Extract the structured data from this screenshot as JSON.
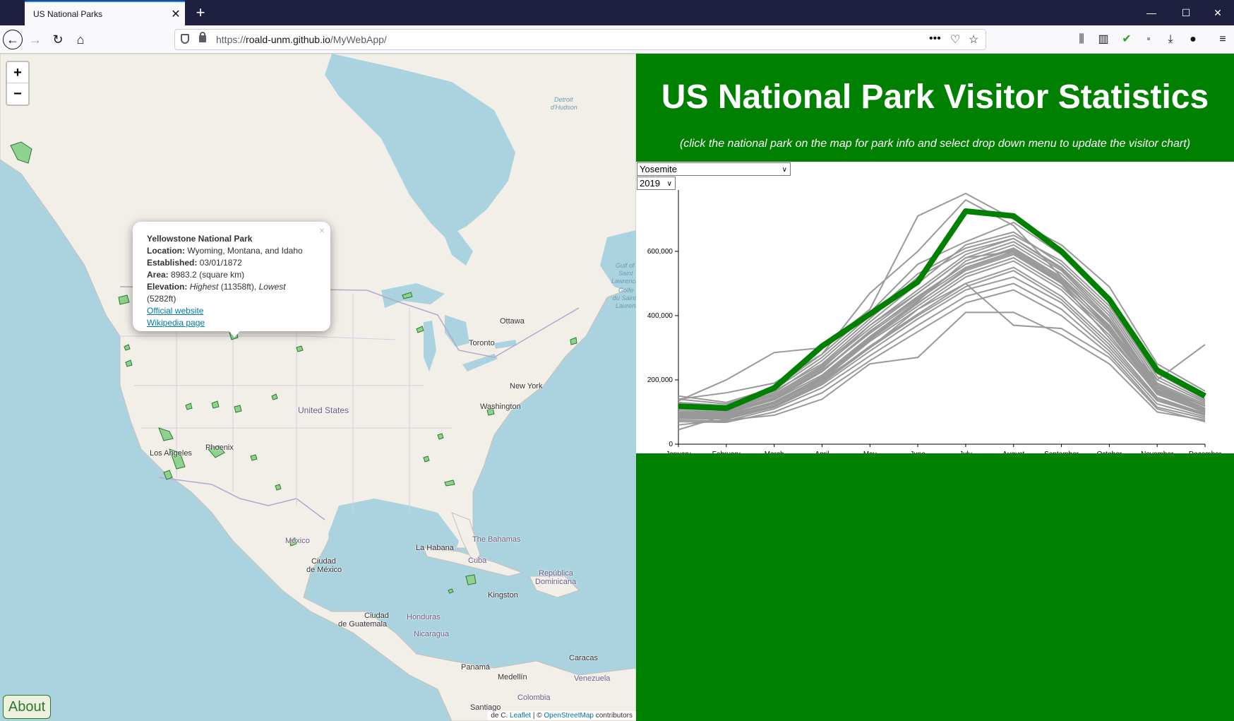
{
  "browser": {
    "tab_title": "US National Parks",
    "url_prefix": "https://",
    "url_host": "roald-unm.github.io",
    "url_path": "/MyWebApp/"
  },
  "map": {
    "zoom_in": "+",
    "zoom_out": "−",
    "popup": {
      "close": "×",
      "name": "Yellowstone National Park",
      "location_label": "Location:",
      "location": "Wyoming, Montana, and Idaho",
      "established_label": "Established:",
      "established": "03/01/1872",
      "area_label": "Area:",
      "area": "8983.2 (square km)",
      "elevation_label": "Elevation:",
      "elev_highest_label": "Highest",
      "elev_highest": "(11358ft),",
      "elev_lowest_label": "Lowest",
      "elev_lowest": "(5282ft)",
      "official_link": "Official website",
      "wiki_link": "Wikipedia page"
    },
    "labels": {
      "ottawa": "Ottawa",
      "toronto": "Toronto",
      "new_york": "New York",
      "washington": "Washington",
      "united_states": "United States",
      "phoenix": "Phoenix",
      "los_angeles": "Los Angeles",
      "mexico": "México",
      "ciudad_mexico_1": "Ciudad",
      "ciudad_mexico_2": "de México",
      "la_habana": "La Habana",
      "the_bahamas": "The Bahamas",
      "cuba": "Cuba",
      "republica_1": "República",
      "republica_2": "Dominicana",
      "kingston": "Kingston",
      "ciudad_guatemala_1": "Ciudad",
      "ciudad_guatemala_2": "de Guatemala",
      "honduras": "Honduras",
      "nicaragua": "Nicaragua",
      "panama": "Panamá",
      "caracas": "Caracas",
      "venezuela": "Venezuela",
      "medellin": "Medellín",
      "colombia": "Colombia",
      "santiago_1": "Santiago",
      "santiago_2": "de C.",
      "detroit": "Detroit",
      "detroit_2": "d'Hudson",
      "gulf": "Gulf of",
      "gulf_2": "Saint",
      "gulf_3": "Lawrence",
      "gulf_4": "Golfe",
      "gulf_5": "du Saint-",
      "gulf_6": "Laurent"
    },
    "about": "About",
    "attribution": {
      "leaflet": "Leaflet",
      "sep": " | © ",
      "osm": "OpenStreetMap",
      "contributors": " contributors"
    },
    "colors": {
      "water": "#aad3df",
      "land": "#f2efe9",
      "park": "#8fd18f",
      "park_stroke": "#2c7a2c"
    }
  },
  "panel": {
    "title": "US National Park Visitor Statistics",
    "subtitle": "(click the national park on the map for park info and select drop down menu to update the visitor chart)",
    "park_select": "Yosemite",
    "year_select": "2019",
    "colors": {
      "bg": "#008000",
      "highlight": "#008000",
      "others": "#999999"
    }
  },
  "chart_data": {
    "type": "line",
    "categories": [
      "January",
      "February",
      "March",
      "April",
      "May",
      "June",
      "July",
      "August",
      "September",
      "October",
      "November",
      "December"
    ],
    "yticks": [
      0,
      200000,
      400000,
      600000
    ],
    "ytick_labels": [
      "0",
      "200,000",
      "400,000",
      "600,000"
    ],
    "ylim": [
      0,
      780000
    ],
    "highlight": {
      "name": "Yosemite",
      "values": [
        118000,
        112000,
        175000,
        305000,
        405000,
        505000,
        725000,
        710000,
        600000,
        450000,
        230000,
        150000
      ]
    },
    "series": [
      {
        "values": [
          130000,
          120000,
          165000,
          250000,
          380000,
          500000,
          620000,
          660000,
          560000,
          420000,
          200000,
          130000
        ]
      },
      {
        "values": [
          110000,
          105000,
          150000,
          240000,
          360000,
          470000,
          580000,
          630000,
          540000,
          390000,
          185000,
          120000
        ]
      },
      {
        "values": [
          100000,
          98000,
          140000,
          225000,
          350000,
          460000,
          560000,
          610000,
          520000,
          380000,
          175000,
          110000
        ]
      },
      {
        "values": [
          95000,
          92000,
          130000,
          210000,
          330000,
          440000,
          540000,
          590000,
          500000,
          360000,
          165000,
          105000
        ]
      },
      {
        "values": [
          90000,
          88000,
          125000,
          200000,
          320000,
          420000,
          520000,
          570000,
          480000,
          340000,
          155000,
          100000
        ]
      },
      {
        "values": [
          85000,
          84000,
          120000,
          195000,
          305000,
          405000,
          500000,
          550000,
          460000,
          320000,
          145000,
          95000
        ]
      },
      {
        "values": [
          120000,
          110000,
          160000,
          260000,
          390000,
          520000,
          600000,
          640000,
          550000,
          410000,
          190000,
          125000
        ]
      },
      {
        "values": [
          140000,
          125000,
          170000,
          270000,
          400000,
          530000,
          610000,
          650000,
          570000,
          430000,
          210000,
          135000
        ]
      },
      {
        "values": [
          80000,
          78000,
          115000,
          185000,
          290000,
          390000,
          480000,
          520000,
          440000,
          300000,
          135000,
          90000
        ]
      },
      {
        "values": [
          75000,
          72000,
          110000,
          175000,
          275000,
          370000,
          460000,
          500000,
          420000,
          290000,
          125000,
          85000
        ]
      },
      {
        "values": [
          105000,
          100000,
          145000,
          230000,
          345000,
          450000,
          550000,
          600000,
          510000,
          370000,
          170000,
          108000
        ]
      },
      {
        "values": [
          115000,
          108000,
          155000,
          245000,
          370000,
          480000,
          590000,
          640000,
          545000,
          400000,
          180000,
          118000
        ]
      },
      {
        "values": [
          98000,
          95000,
          138000,
          215000,
          335000,
          445000,
          570000,
          620000,
          530000,
          385000,
          178000,
          112000
        ]
      },
      {
        "values": [
          88000,
          86000,
          128000,
          205000,
          325000,
          430000,
          530000,
          580000,
          490000,
          350000,
          160000,
          102000
        ]
      },
      {
        "values": [
          82000,
          80000,
          118000,
          190000,
          300000,
          400000,
          490000,
          540000,
          450000,
          310000,
          140000,
          92000
        ]
      },
      {
        "values": [
          125000,
          115000,
          150000,
          235000,
          370000,
          470000,
          580000,
          600000,
          500000,
          330000,
          160000,
          100000
        ]
      },
      {
        "values": [
          135000,
          200000,
          285000,
          300000,
          420000,
          710000,
          780000,
          700000,
          620000,
          490000,
          250000,
          165000
        ]
      },
      {
        "values": [
          140000,
          160000,
          190000,
          280000,
          470000,
          600000,
          760000,
          680000,
          520000,
          360000,
          200000,
          310000
        ]
      },
      {
        "values": [
          70000,
          68000,
          100000,
          160000,
          260000,
          350000,
          440000,
          480000,
          400000,
          280000,
          115000,
          80000
        ]
      },
      {
        "values": [
          45000,
          90000,
          130000,
          200000,
          300000,
          420000,
          500000,
          370000,
          360000,
          270000,
          110000,
          70000
        ]
      },
      {
        "values": [
          60000,
          75000,
          90000,
          140000,
          250000,
          270000,
          410000,
          410000,
          340000,
          250000,
          100000,
          75000
        ]
      },
      {
        "values": [
          150000,
          130000,
          175000,
          280000,
          410000,
          560000,
          630000,
          690000,
          590000,
          440000,
          220000,
          140000
        ]
      },
      {
        "values": [
          112000,
          104000,
          142000,
          228000,
          352000,
          455000,
          560000,
          605000,
          515000,
          365000,
          168000,
          106000
        ]
      },
      {
        "values": [
          92000,
          90000,
          132000,
          208000,
          328000,
          438000,
          545000,
          595000,
          505000,
          355000,
          162000,
          98000
        ]
      }
    ]
  }
}
